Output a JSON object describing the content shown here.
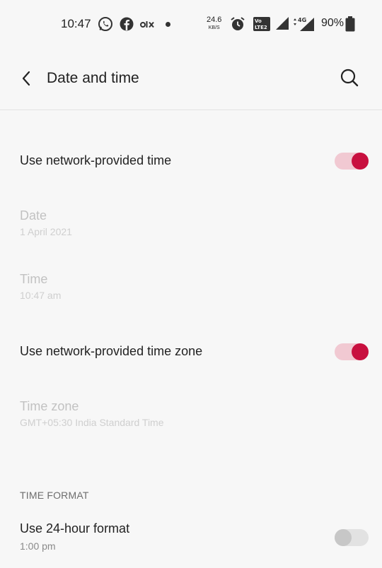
{
  "status_bar": {
    "time": "10:47",
    "net_speed": "24.6",
    "net_unit": "KB/S",
    "battery": "90%",
    "icons": [
      "whatsapp-icon",
      "facebook-icon",
      "olx-icon",
      "dot-icon",
      "alarm-icon",
      "volte-lte-icon",
      "signal-icon",
      "4g-signal-icon",
      "battery-icon"
    ]
  },
  "header": {
    "title": "Date and time"
  },
  "settings": {
    "network_time": {
      "label": "Use network-provided time",
      "enabled": true
    },
    "date": {
      "label": "Date",
      "value": "1 April 2021"
    },
    "time": {
      "label": "Time",
      "value": "10:47 am"
    },
    "network_zone": {
      "label": "Use network-provided time zone",
      "enabled": true
    },
    "time_zone": {
      "label": "Time zone",
      "value": "GMT+05:30 India Standard Time"
    },
    "section_time_format": "TIME FORMAT",
    "format_24h": {
      "label": "Use 24-hour format",
      "value": "1:00 pm",
      "enabled": false
    }
  },
  "colors": {
    "accent": "#c8103f",
    "accent_track": "#f1c9d2",
    "background": "#f7f7f7"
  }
}
